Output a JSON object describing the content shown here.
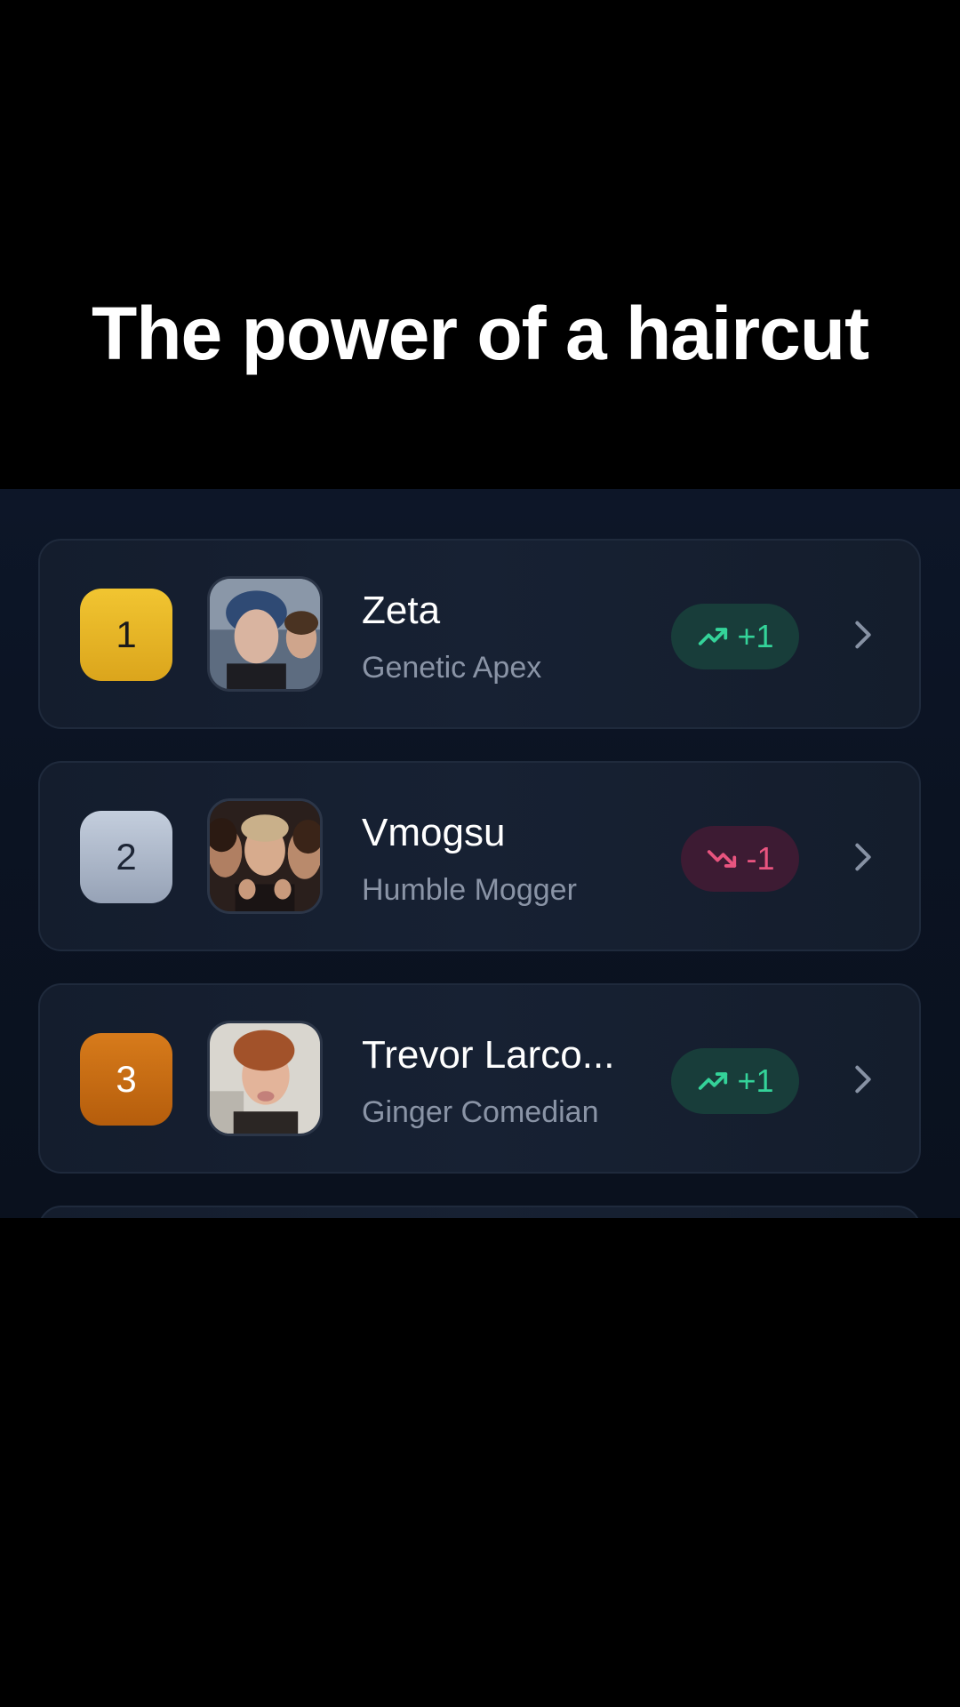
{
  "caption": "The power of a haircut",
  "leaderboard": {
    "rows": [
      {
        "rank": "1",
        "name": "Zeta",
        "subtitle": "Genetic Apex",
        "change": "+1",
        "direction": "up",
        "rank_icon": "gold-rank-badge",
        "avatar": "profile-photo"
      },
      {
        "rank": "2",
        "name": "Vmogsu",
        "subtitle": "Humble Mogger",
        "change": "-1",
        "direction": "down",
        "rank_icon": "silver-rank-badge",
        "avatar": "profile-photo"
      },
      {
        "rank": "3",
        "name": "Trevor Larco...",
        "subtitle": "Ginger Comedian",
        "change": "+1",
        "direction": "up",
        "rank_icon": "bronze-rank-badge",
        "avatar": "profile-photo"
      }
    ],
    "colors": {
      "gold": "#e6b524",
      "silver": "#aab5c6",
      "bronze": "#c76c13",
      "up": "#34d399",
      "down": "#e8547f"
    }
  }
}
